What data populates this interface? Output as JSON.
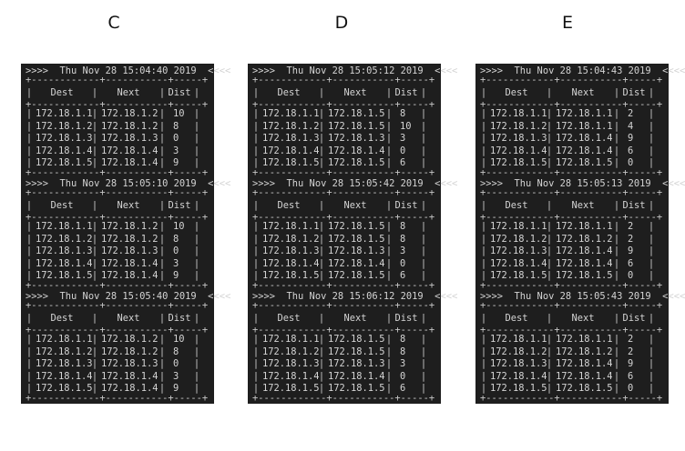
{
  "columns_header": {
    "dest": "Dest",
    "next": "Next",
    "dist": "Dist"
  },
  "panels": [
    {
      "label": "C",
      "snapshots": [
        {
          "header": ">>>>  Thu Nov 28 15:04:40 2019  <<<<",
          "rows": [
            [
              "172.18.1.1",
              "172.18.1.2",
              "10"
            ],
            [
              "172.18.1.2",
              "172.18.1.2",
              "8"
            ],
            [
              "172.18.1.3",
              "172.18.1.3",
              "0"
            ],
            [
              "172.18.1.4",
              "172.18.1.4",
              "3"
            ],
            [
              "172.18.1.5",
              "172.18.1.4",
              "9"
            ]
          ]
        },
        {
          "header": ">>>>  Thu Nov 28 15:05:10 2019  <<<<",
          "rows": [
            [
              "172.18.1.1",
              "172.18.1.2",
              "10"
            ],
            [
              "172.18.1.2",
              "172.18.1.2",
              "8"
            ],
            [
              "172.18.1.3",
              "172.18.1.3",
              "0"
            ],
            [
              "172.18.1.4",
              "172.18.1.4",
              "3"
            ],
            [
              "172.18.1.5",
              "172.18.1.4",
              "9"
            ]
          ]
        },
        {
          "header": ">>>>  Thu Nov 28 15:05:40 2019  <<<<",
          "rows": [
            [
              "172.18.1.1",
              "172.18.1.2",
              "10"
            ],
            [
              "172.18.1.2",
              "172.18.1.2",
              "8"
            ],
            [
              "172.18.1.3",
              "172.18.1.3",
              "0"
            ],
            [
              "172.18.1.4",
              "172.18.1.4",
              "3"
            ],
            [
              "172.18.1.5",
              "172.18.1.4",
              "9"
            ]
          ]
        }
      ]
    },
    {
      "label": "D",
      "snapshots": [
        {
          "header": ">>>>  Thu Nov 28 15:05:12 2019  <<<<",
          "rows": [
            [
              "172.18.1.1",
              "172.18.1.5",
              "8"
            ],
            [
              "172.18.1.2",
              "172.18.1.5",
              "10"
            ],
            [
              "172.18.1.3",
              "172.18.1.3",
              "3"
            ],
            [
              "172.18.1.4",
              "172.18.1.4",
              "0"
            ],
            [
              "172.18.1.5",
              "172.18.1.5",
              "6"
            ]
          ]
        },
        {
          "header": ">>>>  Thu Nov 28 15:05:42 2019  <<<<",
          "rows": [
            [
              "172.18.1.1",
              "172.18.1.5",
              "8"
            ],
            [
              "172.18.1.2",
              "172.18.1.5",
              "8"
            ],
            [
              "172.18.1.3",
              "172.18.1.3",
              "3"
            ],
            [
              "172.18.1.4",
              "172.18.1.4",
              "0"
            ],
            [
              "172.18.1.5",
              "172.18.1.5",
              "6"
            ]
          ]
        },
        {
          "header": ">>>>  Thu Nov 28 15:06:12 2019  <<<<",
          "rows": [
            [
              "172.18.1.1",
              "172.18.1.5",
              "8"
            ],
            [
              "172.18.1.2",
              "172.18.1.5",
              "8"
            ],
            [
              "172.18.1.3",
              "172.18.1.3",
              "3"
            ],
            [
              "172.18.1.4",
              "172.18.1.4",
              "0"
            ],
            [
              "172.18.1.5",
              "172.18.1.5",
              "6"
            ]
          ]
        }
      ]
    },
    {
      "label": "E",
      "snapshots": [
        {
          "header": ">>>>  Thu Nov 28 15:04:43 2019  <<<<",
          "rows": [
            [
              "172.18.1.1",
              "172.18.1.1",
              "2"
            ],
            [
              "172.18.1.2",
              "172.18.1.1",
              "4"
            ],
            [
              "172.18.1.3",
              "172.18.1.4",
              "9"
            ],
            [
              "172.18.1.4",
              "172.18.1.4",
              "6"
            ],
            [
              "172.18.1.5",
              "172.18.1.5",
              "0"
            ]
          ]
        },
        {
          "header": ">>>>  Thu Nov 28 15:05:13 2019  <<<<",
          "rows": [
            [
              "172.18.1.1",
              "172.18.1.1",
              "2"
            ],
            [
              "172.18.1.2",
              "172.18.1.2",
              "2"
            ],
            [
              "172.18.1.3",
              "172.18.1.4",
              "9"
            ],
            [
              "172.18.1.4",
              "172.18.1.4",
              "6"
            ],
            [
              "172.18.1.5",
              "172.18.1.5",
              "0"
            ]
          ]
        },
        {
          "header": ">>>>  Thu Nov 28 15:05:43 2019  <<<<",
          "rows": [
            [
              "172.18.1.1",
              "172.18.1.1",
              "2"
            ],
            [
              "172.18.1.2",
              "172.18.1.2",
              "2"
            ],
            [
              "172.18.1.3",
              "172.18.1.4",
              "9"
            ],
            [
              "172.18.1.4",
              "172.18.1.4",
              "6"
            ],
            [
              "172.18.1.5",
              "172.18.1.5",
              "0"
            ]
          ]
        }
      ]
    }
  ]
}
